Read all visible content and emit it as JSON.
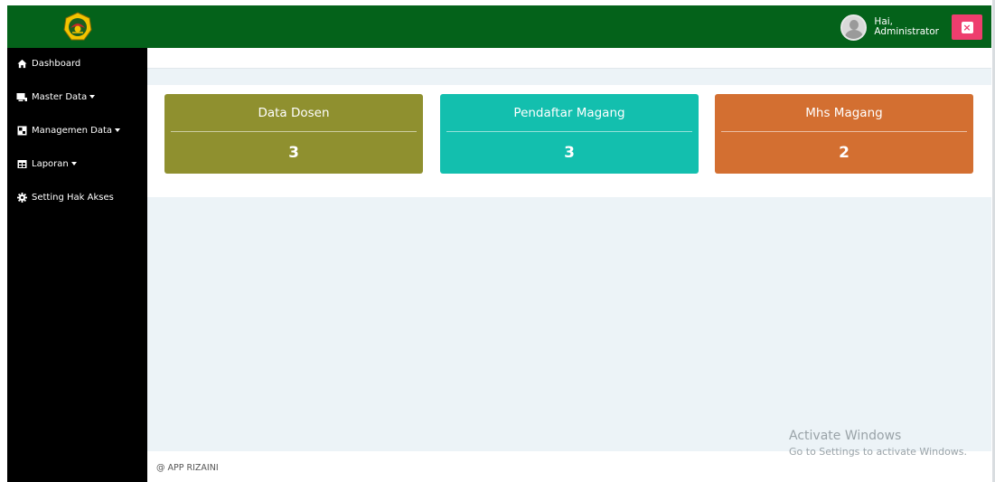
{
  "header": {
    "user_greeting": "Hai,",
    "user_name": "Administrator",
    "logout_icon": "close-icon"
  },
  "sidebar": {
    "items": [
      {
        "label": "Dashboard",
        "icon": "home-icon",
        "has_caret": false
      },
      {
        "label": "Master Data",
        "icon": "desktop-icon",
        "has_caret": true
      },
      {
        "label": "Managemen Data",
        "icon": "image-icon",
        "has_caret": true
      },
      {
        "label": "Laporan",
        "icon": "table-icon",
        "has_caret": true
      },
      {
        "label": "Setting Hak Akses",
        "icon": "gear-icon",
        "has_caret": false
      }
    ]
  },
  "cards": [
    {
      "title": "Data Dosen",
      "value": "3",
      "color": "#8f902f"
    },
    {
      "title": "Pendaftar Magang",
      "value": "3",
      "color": "#13bfae"
    },
    {
      "title": "Mhs Magang",
      "value": "2",
      "color": "#d36f31"
    }
  ],
  "footer": {
    "text": "@ APP RIZAINI"
  },
  "watermark": {
    "title": "Activate Windows",
    "subtitle": "Go to Settings to activate Windows."
  },
  "colors": {
    "topbar": "#04621a",
    "sidebar": "#000000",
    "logout": "#ee3e6e",
    "content_bg": "#ecf3f7"
  }
}
